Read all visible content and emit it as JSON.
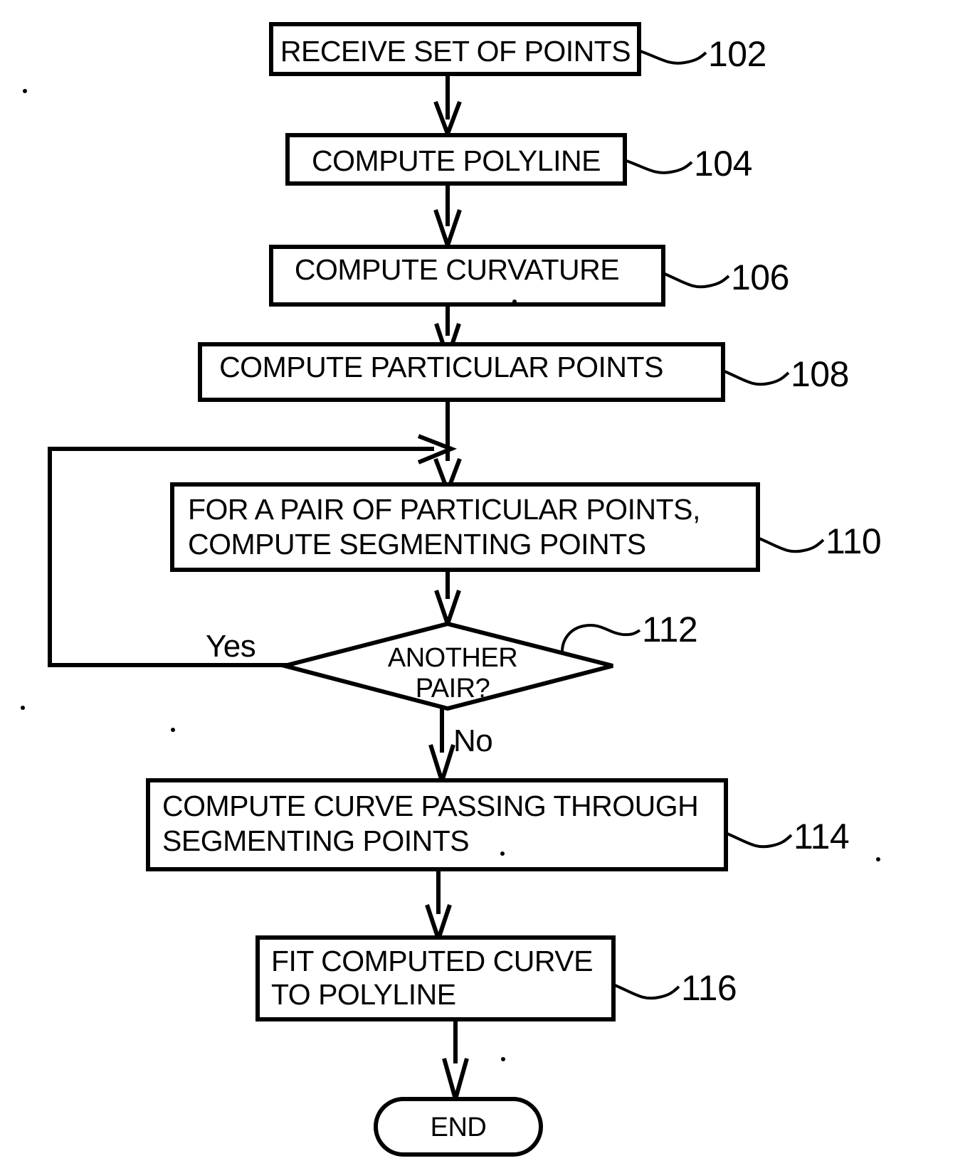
{
  "figure": {
    "type": "flowchart",
    "orientation": "vertical",
    "nodes": [
      {
        "id": "102",
        "shape": "process",
        "text": "RECEIVE SET OF POINTS",
        "ref": "102"
      },
      {
        "id": "104",
        "shape": "process",
        "text": "COMPUTE POLYLINE",
        "ref": "104"
      },
      {
        "id": "106",
        "shape": "process",
        "text": "COMPUTE CURVATURE",
        "ref": "106"
      },
      {
        "id": "108",
        "shape": "process",
        "text": "COMPUTE PARTICULAR POINTS",
        "ref": "108"
      },
      {
        "id": "110",
        "shape": "process",
        "text_line1": "FOR A PAIR OF PARTICULAR POINTS,",
        "text_line2": "COMPUTE SEGMENTING POINTS",
        "ref": "110"
      },
      {
        "id": "112",
        "shape": "decision",
        "text_line1": "ANOTHER",
        "text_line2": "PAIR?",
        "ref": "112"
      },
      {
        "id": "114",
        "shape": "process",
        "text_line1": "COMPUTE CURVE PASSING THROUGH",
        "text_line2": "SEGMENTING POINTS",
        "ref": "114"
      },
      {
        "id": "116",
        "shape": "process",
        "text_line1": "FIT COMPUTED CURVE",
        "text_line2": "TO POLYLINE",
        "ref": "116"
      },
      {
        "id": "end",
        "shape": "terminator",
        "text": "END"
      }
    ],
    "branch_labels": {
      "yes": "Yes",
      "no": "No"
    },
    "colors": {
      "stroke": "#000000",
      "fill": "#ffffff",
      "background": "#ffffff"
    }
  }
}
